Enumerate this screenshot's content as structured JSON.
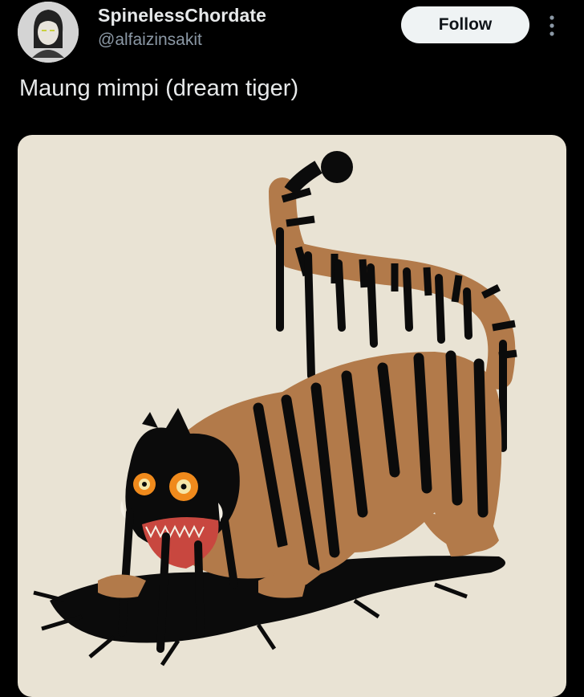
{
  "author": {
    "display_name": "SpinelessChordate",
    "handle": "@alfaizinsakit",
    "avatar_icon": "avatar-drawing"
  },
  "actions": {
    "follow_label": "Follow",
    "more_icon": "more-vertical-icon"
  },
  "post": {
    "text": "Maung mimpi (dream tiger)",
    "media_description_icon": "tiger-illustration"
  },
  "colors": {
    "background": "#000000",
    "text_primary": "#e7e9ea",
    "text_secondary": "#8b98a5",
    "follow_bg": "#eff3f4",
    "media_bg": "#e9e3d4",
    "tiger_fur": "#b27a4a",
    "tiger_stripe": "#0b0b0b",
    "eye": "#f08a1c"
  }
}
